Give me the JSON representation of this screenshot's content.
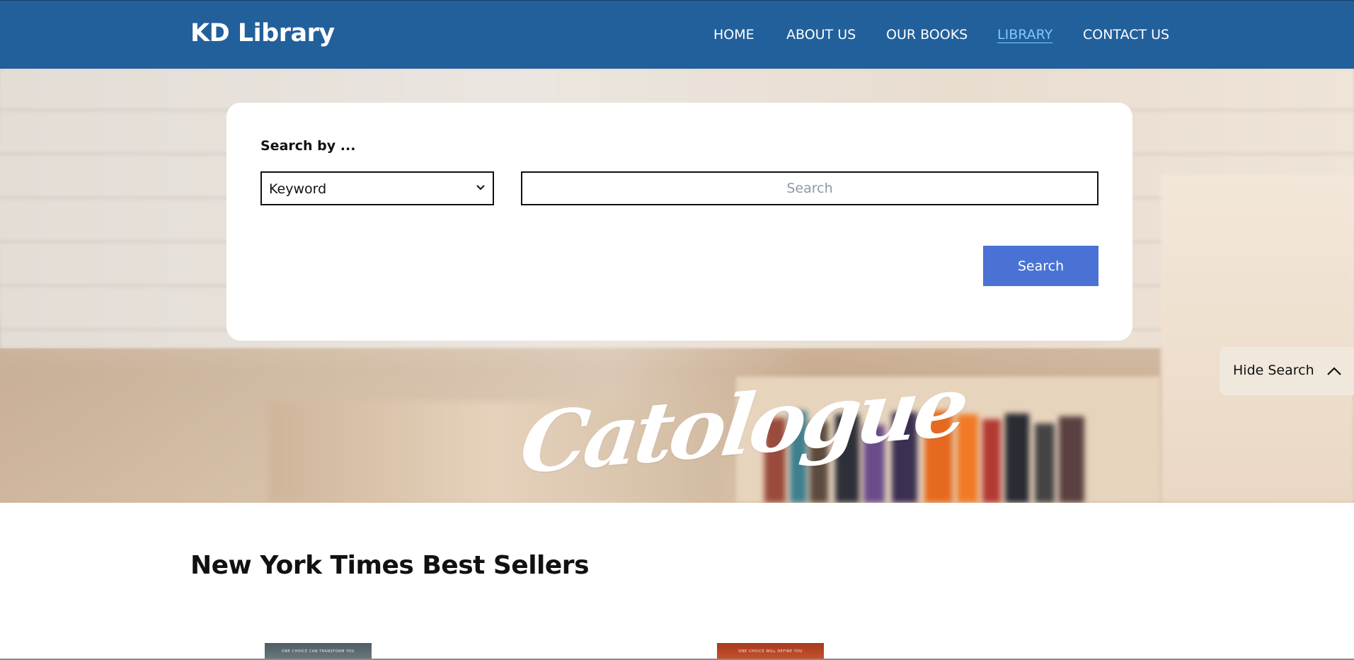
{
  "header": {
    "brand": "KD Library",
    "nav": [
      {
        "label": "HOME",
        "active": false
      },
      {
        "label": "ABOUT US",
        "active": false
      },
      {
        "label": "OUR BOOKS",
        "active": false
      },
      {
        "label": "LIBRARY",
        "active": true
      },
      {
        "label": "CONTACT US",
        "active": false
      }
    ]
  },
  "search": {
    "heading": "Search by ...",
    "select_value": "Keyword",
    "input_placeholder": "Search",
    "input_value": "",
    "button_label": "Search"
  },
  "hero": {
    "title": "Catologue"
  },
  "toggle": {
    "label": "Hide Search"
  },
  "section": {
    "title": "New York Times Best Sellers",
    "books": [
      {
        "tagline": "ONE CHOICE CAN TRANSFORM YOU"
      },
      {
        "tagline": "ONE CHOICE WILL DEFINE YOU"
      }
    ]
  },
  "colors": {
    "header_bg": "#22609c",
    "active_nav": "#7fc8ff",
    "button_bg": "#4a72d4"
  },
  "icons": {
    "select_chevron": "chevron-down-icon",
    "toggle_chevron": "chevron-up-icon"
  }
}
